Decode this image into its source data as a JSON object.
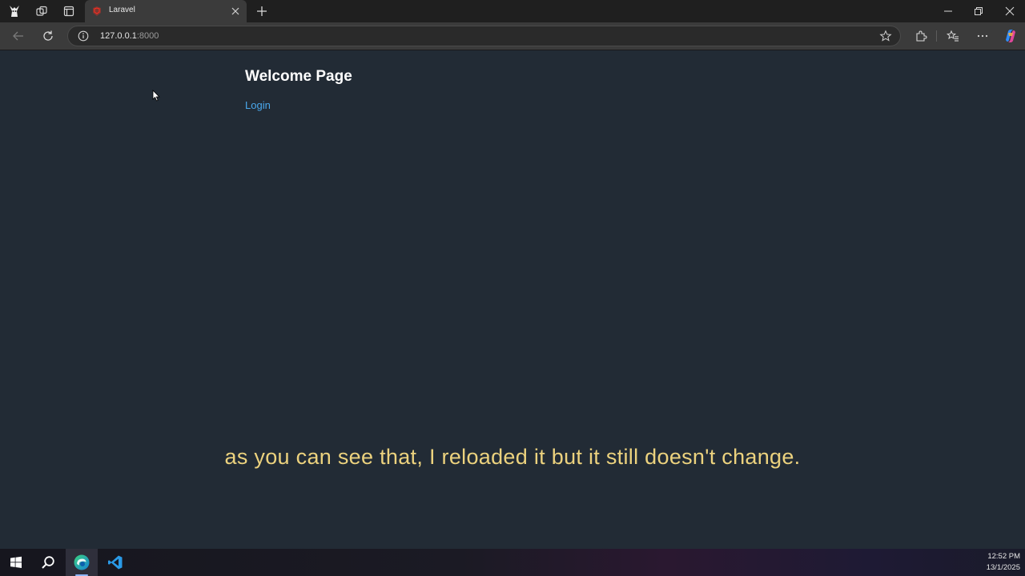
{
  "browser": {
    "tab": {
      "title": "Laravel"
    },
    "address": {
      "host": "127.0.0.1",
      "port": ":8000"
    }
  },
  "page": {
    "heading": "Welcome Page",
    "login_link": "Login"
  },
  "caption": "as you can see that, I reloaded it but it still doesn't change.",
  "taskbar": {
    "time": "12:52 PM",
    "date": "13/1/2025"
  },
  "colors": {
    "page_background": "#222b35",
    "link": "#4aa8ec",
    "caption": "#ecd27e",
    "laravel_red": "#ff2d20"
  },
  "icons": [
    "profile-icon",
    "workspaces-icon",
    "tab-actions-icon",
    "laravel-favicon",
    "close-icon",
    "plus-icon",
    "minimize-icon",
    "restore-icon",
    "back-icon",
    "refresh-icon",
    "info-icon",
    "star-icon",
    "extensions-icon",
    "favorites-icon",
    "more-icon",
    "copilot-icon",
    "windows-start-icon",
    "search-icon",
    "edge-icon",
    "vscode-icon"
  ]
}
